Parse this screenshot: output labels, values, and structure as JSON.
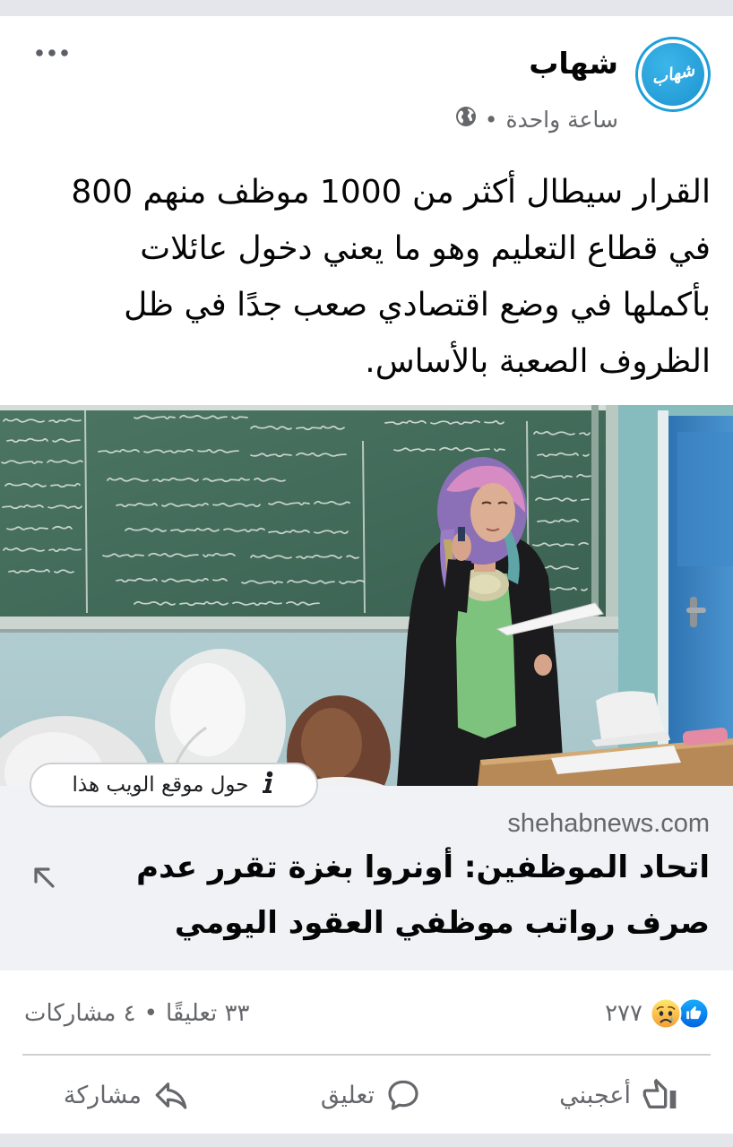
{
  "colors": {
    "page_background": "#e4e6eb",
    "card_background": "#ffffff",
    "primary_text": "#050505",
    "secondary_text": "#65676b",
    "link_background": "#f0f2f5",
    "like_blue": "#1877f2",
    "avatar_ring": "#1e9fd9"
  },
  "post": {
    "author": "شهاب",
    "avatar_logo_text": "شهاب",
    "time": "ساعة واحدة",
    "meta_separator": "•",
    "privacy_icon": "globe-icon",
    "more_icon": "more-horizontal-icon",
    "text_lines": [
      "القرار سيطال أكثر من 1000 موظف منهم 800",
      "في قطاع التعليم وهو ما يعني دخول عائلات",
      "بأكملها في وضع اقتصادي صعب جدًا في ظل",
      "الظروف الصعبة بالأساس."
    ]
  },
  "media": {
    "about_website_label": "حول موقع الويب هذا",
    "info_icon": "info-icon"
  },
  "link_preview": {
    "domain": "shehabnews.com",
    "title_lines": [
      "اتحاد الموظفين: أونروا بغزة تقرر عدم",
      "صرف رواتب موظفي العقود اليومي"
    ],
    "open_icon": "external-link-arrow-icon"
  },
  "engagement": {
    "reaction_icons": [
      "like-icon",
      "sad-icon"
    ],
    "reaction_count": "٢٧٧",
    "comments": "٣٣ تعليقًا",
    "separator": "•",
    "shares": "٤ مشاركات"
  },
  "actions": {
    "like": {
      "label": "أعجبني",
      "icon": "thumbs-up-icon"
    },
    "comment": {
      "label": "تعليق",
      "icon": "comment-icon"
    },
    "share": {
      "label": "مشاركة",
      "icon": "share-icon"
    }
  }
}
